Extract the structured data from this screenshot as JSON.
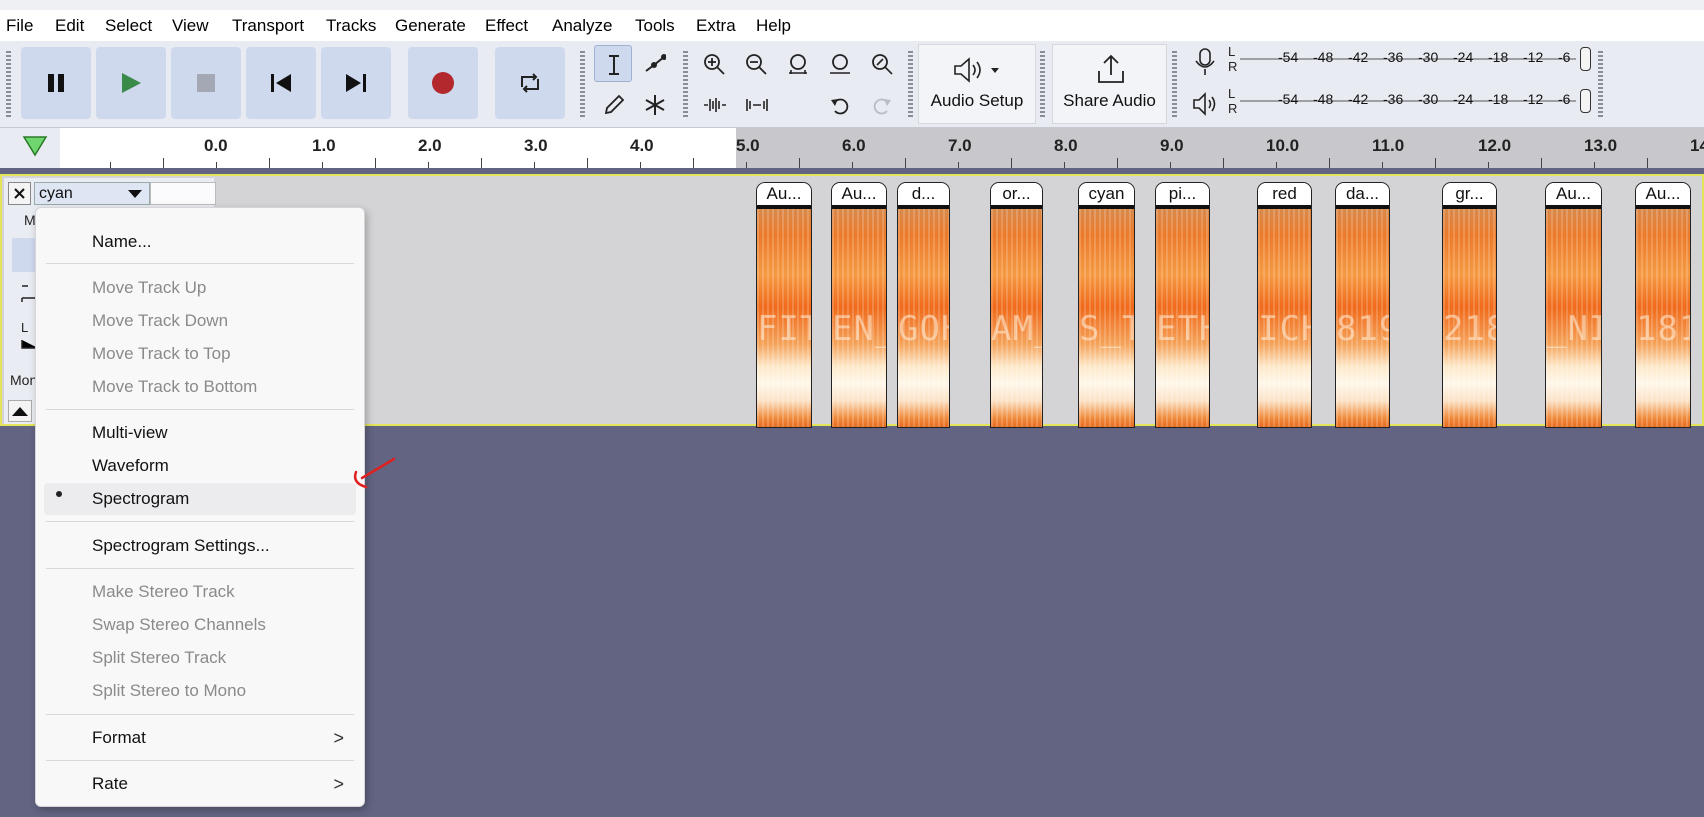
{
  "menubar": {
    "items": [
      "File",
      "Edit",
      "Select",
      "View",
      "Transport",
      "Tracks",
      "Generate",
      "Effect",
      "Analyze",
      "Tools",
      "Extra",
      "Help"
    ]
  },
  "toolbar": {
    "audio_setup_label": "Audio Setup",
    "share_audio_label": "Share Audio",
    "meter_channels": [
      "L",
      "R"
    ],
    "meter_scale": [
      "-54",
      "-48",
      "-42",
      "-36",
      "-30",
      "-24",
      "-18",
      "-12",
      "-6"
    ]
  },
  "ruler": {
    "labels": [
      "0.0",
      "1.0",
      "2.0",
      "3.0",
      "4.0",
      "5.0",
      "6.0",
      "7.0",
      "8.0",
      "9.0",
      "10.0",
      "11.0",
      "12.0",
      "13.0",
      "14"
    ]
  },
  "track": {
    "name": "cyan",
    "side_fragments": [
      "M",
      "Mon"
    ],
    "clips": [
      {
        "title": "Au...",
        "ghost": "FIT"
      },
      {
        "title": "Au...",
        "ghost": "EN_"
      },
      {
        "title": "d...",
        "ghost": "GOH"
      },
      {
        "title": "or...",
        "ghost": "AM_"
      },
      {
        "title": "cyan",
        "ghost": "S_T"
      },
      {
        "title": "pi...",
        "ghost": "ETH"
      },
      {
        "title": "red",
        "ghost": "ICH"
      },
      {
        "title": "da...",
        "ghost": "819"
      },
      {
        "title": "gr...",
        "ghost": "218"
      },
      {
        "title": "Au...",
        "ghost": "_NI"
      },
      {
        "title": "Au...",
        "ghost": "181"
      }
    ]
  },
  "context_menu": {
    "name": "Name...",
    "move_up": "Move Track Up",
    "move_down": "Move Track Down",
    "move_top": "Move Track to Top",
    "move_bottom": "Move Track to Bottom",
    "multiview": "Multi-view",
    "waveform": "Waveform",
    "spectrogram": "Spectrogram",
    "spectrogram_settings": "Spectrogram Settings...",
    "make_stereo": "Make Stereo Track",
    "swap_stereo": "Swap Stereo Channels",
    "split_stereo": "Split Stereo Track",
    "split_mono": "Split Stereo to Mono",
    "format": "Format",
    "rate": "Rate",
    "submenu_arrow": ">"
  },
  "colors": {
    "background": "#626482",
    "track_border": "#e4e45a",
    "record": "#b3282d",
    "play": "#3a8a4a",
    "annotation_arrow": "#e02020"
  }
}
